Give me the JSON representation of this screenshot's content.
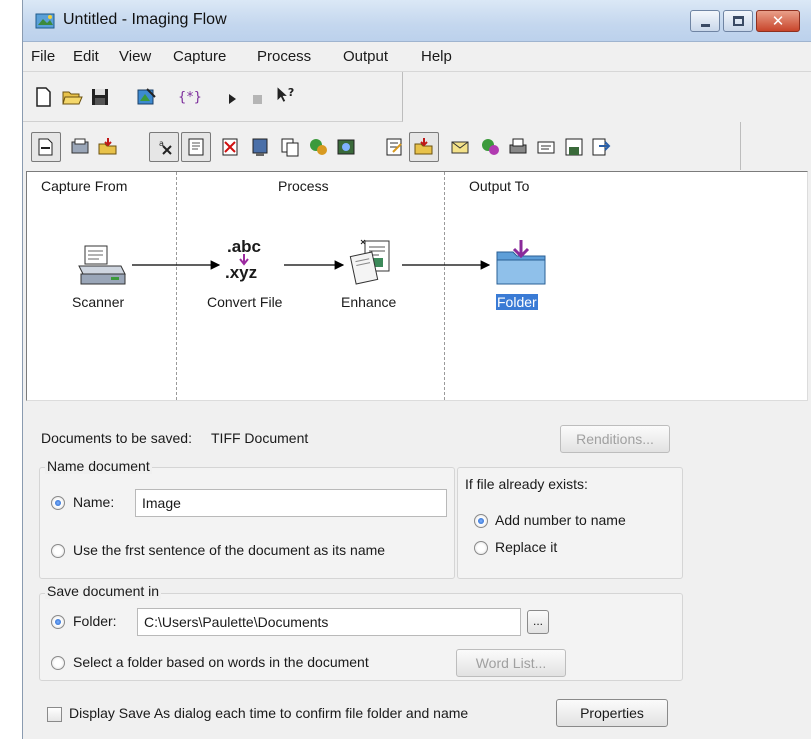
{
  "window": {
    "title": "Untitled - Imaging Flow"
  },
  "menu": [
    "File",
    "Edit",
    "View",
    "Capture",
    "Process",
    "Output",
    "Help"
  ],
  "toolbar1": [
    "new-document-icon",
    "open-folder-icon",
    "save-icon",
    "workflow-icon",
    "braces-icon",
    "play-icon",
    "stop-icon",
    "help-pointer-icon"
  ],
  "toolbar2": [
    "capture-scanner-icon",
    "capture-fax-icon",
    "capture-folder-icon",
    "convert-ocr-icon",
    "convert-text-icon",
    "delete-page-icon",
    "document-icon",
    "copy-icon",
    "plugin-icon",
    "image-tools-icon",
    "output-edit-icon",
    "output-folder-icon",
    "output-mail-icon",
    "output-plugin-icon",
    "print-icon",
    "fax-out-icon",
    "save-disk-icon",
    "export-icon"
  ],
  "flow": {
    "headers": {
      "capture": "Capture From",
      "process": "Process",
      "output": "Output To"
    },
    "nodes": {
      "scanner": "Scanner",
      "convert": "Convert File",
      "enhance": "Enhance",
      "folder": "Folder"
    },
    "convert_icon_text": {
      "top": ".abc",
      "bottom": ".xyz"
    }
  },
  "details": {
    "docs_label": "Documents to be saved:",
    "docs_value": "TIFF Document",
    "renditions_button": "Renditions...",
    "name_group": {
      "title": "Name document",
      "name_radio": "Name:",
      "name_value": "Image",
      "first_sentence_radio": "Use the frst sentence of the document as its name"
    },
    "exists_group": {
      "title": "If file already exists:",
      "add_number": "Add number to name",
      "replace": "Replace it"
    },
    "save_group": {
      "title": "Save document in",
      "folder_radio": "Folder:",
      "folder_value": "C:\\Users\\Paulette\\Documents",
      "browse_button": "...",
      "select_folder_radio": "Select a folder based on words in the document",
      "word_list_button": "Word List..."
    },
    "save_as_checkbox": "Display Save As dialog each time to confirm file folder and name",
    "properties_button": "Properties"
  }
}
